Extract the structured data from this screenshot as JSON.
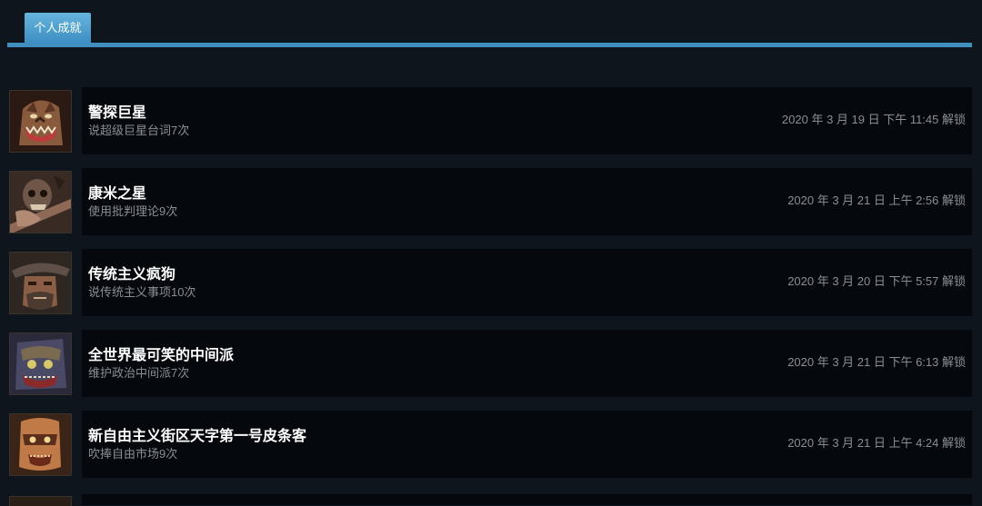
{
  "tabs": [
    {
      "label": "个人成就",
      "active": true
    }
  ],
  "achievements": [
    {
      "title": "警探巨星",
      "desc": "说超级巨星台词7次",
      "date": "2020 年 3 月 19 日 下午 11:45 解锁",
      "icon": "wolf-face-icon"
    },
    {
      "title": "康米之星",
      "desc": "使用批判理论9次",
      "date": "2020 年 3 月 21 日 上午 2:56 解锁",
      "icon": "skull-bat-icon"
    },
    {
      "title": "传统主义疯狗",
      "desc": "说传统主义事项10次",
      "date": "2020 年 3 月 20 日 下午 5:57 解锁",
      "icon": "hat-man-icon"
    },
    {
      "title": "全世界最可笑的中间派",
      "desc": "维护政治中间派7次",
      "date": "2020 年 3 月 21 日 下午 6:13 解锁",
      "icon": "mask-face-icon"
    },
    {
      "title": "新自由主义街区天字第一号皮条客",
      "desc": "吹捧自由市场9次",
      "date": "2020 年 3 月 21 日 上午 4:24 解锁",
      "icon": "masked-man-icon"
    }
  ],
  "colors": {
    "accent": "#3f8fbf",
    "background": "#0f151d",
    "card": "#05090d"
  }
}
